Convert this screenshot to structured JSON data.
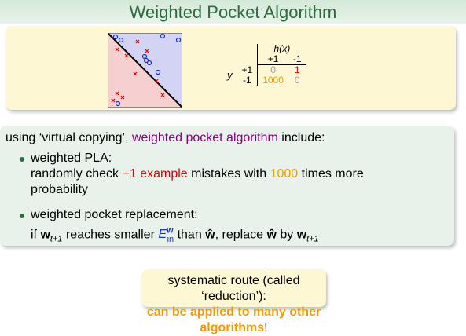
{
  "header": {
    "title": "Weighted Pocket Algorithm"
  },
  "cost_table": {
    "h_label": "h(x)",
    "col_headers": [
      "+1",
      "-1"
    ],
    "y_label": "y",
    "rows": [
      {
        "label": "+1",
        "cells": [
          "0",
          "1"
        ]
      },
      {
        "label": "-1",
        "cells": [
          "1000",
          "0"
        ]
      }
    ]
  },
  "main": {
    "intro_pre": "using ‘virtual copying’, ",
    "intro_highlight": "weighted pocket algorithm",
    "intro_post": " include:",
    "b1_title": "weighted PLA:",
    "b1_pre": "randomly check ",
    "b1_red": "−1 example",
    "b1_mid": " mistakes with ",
    "b1_orange": "1000",
    "b1_post": " times more",
    "b1_line3": "probability",
    "b2_title": "weighted pocket replacement:",
    "b2_a": "if ",
    "b2_w": "w",
    "b2_sub": "t+1",
    "b2_b": " reaches smaller ",
    "b2_E": "E",
    "b2_E_sup": "w",
    "b2_E_sub": "in",
    "b2_c": " than ",
    "b2_what": "ŵ",
    "b2_d": ", replace ",
    "b2_what2": "ŵ",
    "b2_e": " by ",
    "b2_w2": "w",
    "b2_sub2": "t+1"
  },
  "footer": {
    "line1": "systematic route (called ‘reduction’):",
    "line2": "can be applied to many other algorithms",
    "line2_end": "!"
  }
}
